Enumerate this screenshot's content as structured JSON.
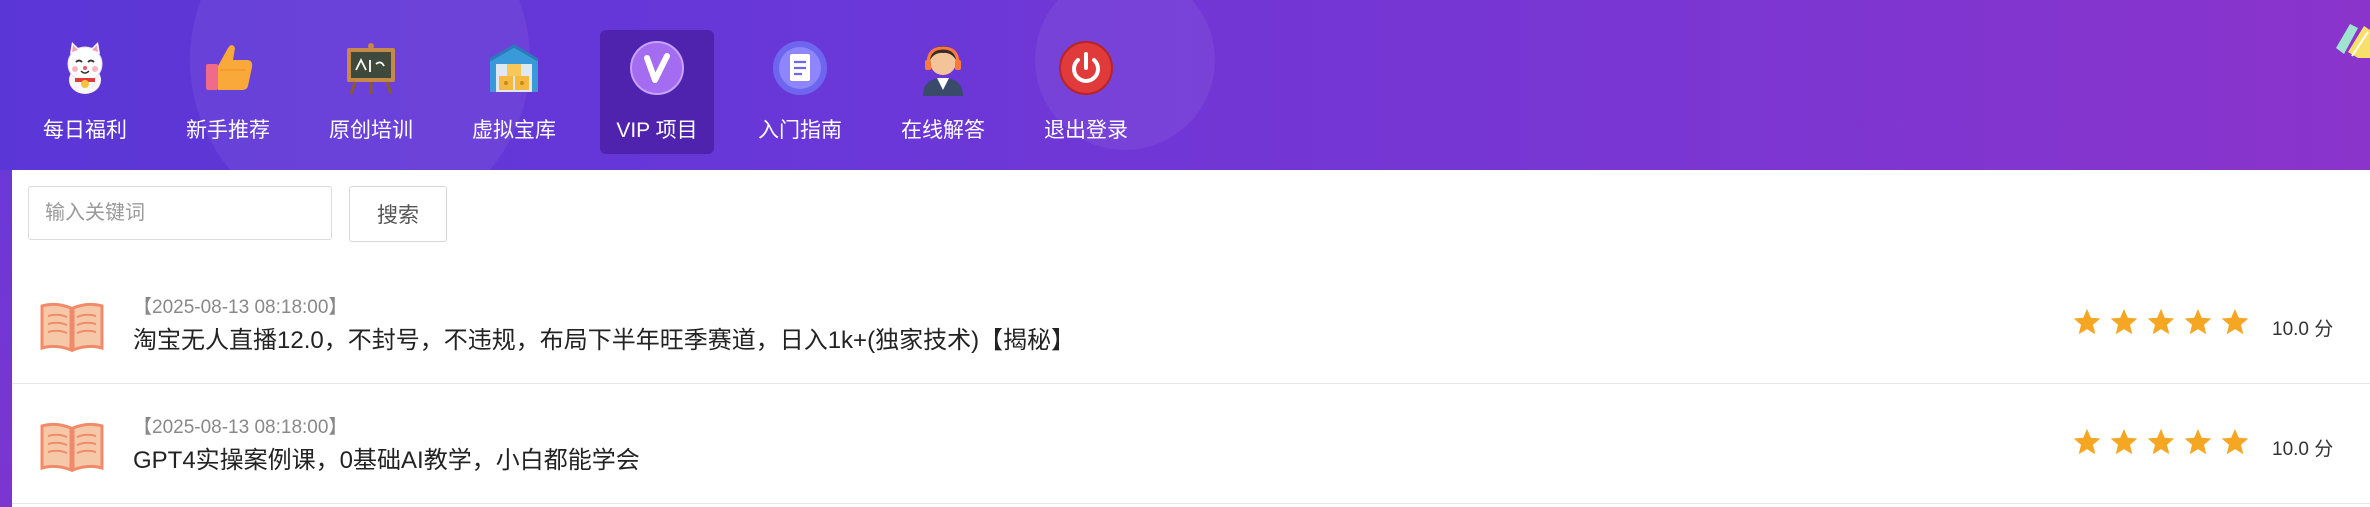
{
  "nav": [
    {
      "label": "每日福利",
      "icon": "lucky-cat-icon"
    },
    {
      "label": "新手推荐",
      "icon": "thumbs-up-icon"
    },
    {
      "label": "原创培训",
      "icon": "blackboard-icon"
    },
    {
      "label": "虚拟宝库",
      "icon": "warehouse-icon"
    },
    {
      "label": "VIP 项目",
      "icon": "vip-icon",
      "active": true
    },
    {
      "label": "入门指南",
      "icon": "document-icon"
    },
    {
      "label": "在线解答",
      "icon": "support-agent-icon"
    },
    {
      "label": "退出登录",
      "icon": "power-icon"
    }
  ],
  "search": {
    "placeholder": "输入关键词",
    "value": "",
    "button_label": "搜索"
  },
  "articles": [
    {
      "date": "【2025-08-13 08:18:00】",
      "title": "淘宝无人直播12.0，不封号，不违规，布局下半年旺季赛道，日入1k+(独家技术)【揭秘】",
      "rating": 5,
      "score": "10.0 分"
    },
    {
      "date": "【2025-08-13 08:18:00】",
      "title": "GPT4实操案例课，0基础AI教学，小白都能学会",
      "rating": 5,
      "score": "10.0 分"
    }
  ],
  "colors": {
    "header_start": "#5b36d6",
    "header_end": "#8a34cc",
    "star": "#f5a623",
    "book": "#f08a6a"
  }
}
